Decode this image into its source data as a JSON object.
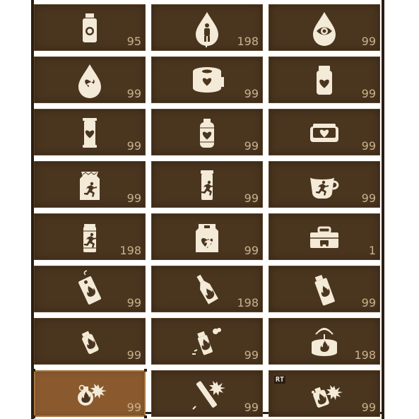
{
  "inventory": {
    "slots": [
      {
        "icon": "medicine-bottle-icon",
        "count": "95"
      },
      {
        "icon": "blood-drop-person-icon",
        "count": "198"
      },
      {
        "icon": "blood-drop-eye-icon",
        "count": "99"
      },
      {
        "icon": "blood-drop-heart-icon",
        "count": "99"
      },
      {
        "icon": "bandage-roll-icon",
        "count": "99"
      },
      {
        "icon": "pill-jar-heart-icon",
        "count": "99"
      },
      {
        "icon": "canister-heart-icon",
        "count": "99"
      },
      {
        "icon": "bottle-heart-icon",
        "count": "99"
      },
      {
        "icon": "medkit-heart-icon",
        "count": "99"
      },
      {
        "icon": "food-bag-runner-icon",
        "count": "99"
      },
      {
        "icon": "canister-runner-icon",
        "count": "99"
      },
      {
        "icon": "coffee-cup-runner-icon",
        "count": "99"
      },
      {
        "icon": "drink-can-runner-icon",
        "count": "198"
      },
      {
        "icon": "food-bag-heart-runner-icon",
        "count": "99"
      },
      {
        "icon": "toolbox-vehicle-icon",
        "count": "1"
      },
      {
        "icon": "fire-tag-icon",
        "count": "99"
      },
      {
        "icon": "fire-bottle-icon",
        "count": "198"
      },
      {
        "icon": "fire-spray-icon",
        "count": "99"
      },
      {
        "icon": "fire-canister-icon",
        "count": "99"
      },
      {
        "icon": "fire-spray-burst-icon",
        "count": "99"
      },
      {
        "icon": "fire-cake-alarm-icon",
        "count": "198"
      },
      {
        "icon": "grenade-blast-icon",
        "count": "99",
        "selected": true
      },
      {
        "icon": "dynamite-stick-blast-icon",
        "count": "99"
      },
      {
        "icon": "gas-can-blast-icon",
        "count": "99",
        "badge": "RT"
      }
    ]
  },
  "colors": {
    "slot_bg": "#4a351f",
    "slot_selected_bg": "#8a5a2e",
    "icon": "#f3ead7",
    "count_text": "#c9b28d",
    "frame": "#2a1d12"
  }
}
